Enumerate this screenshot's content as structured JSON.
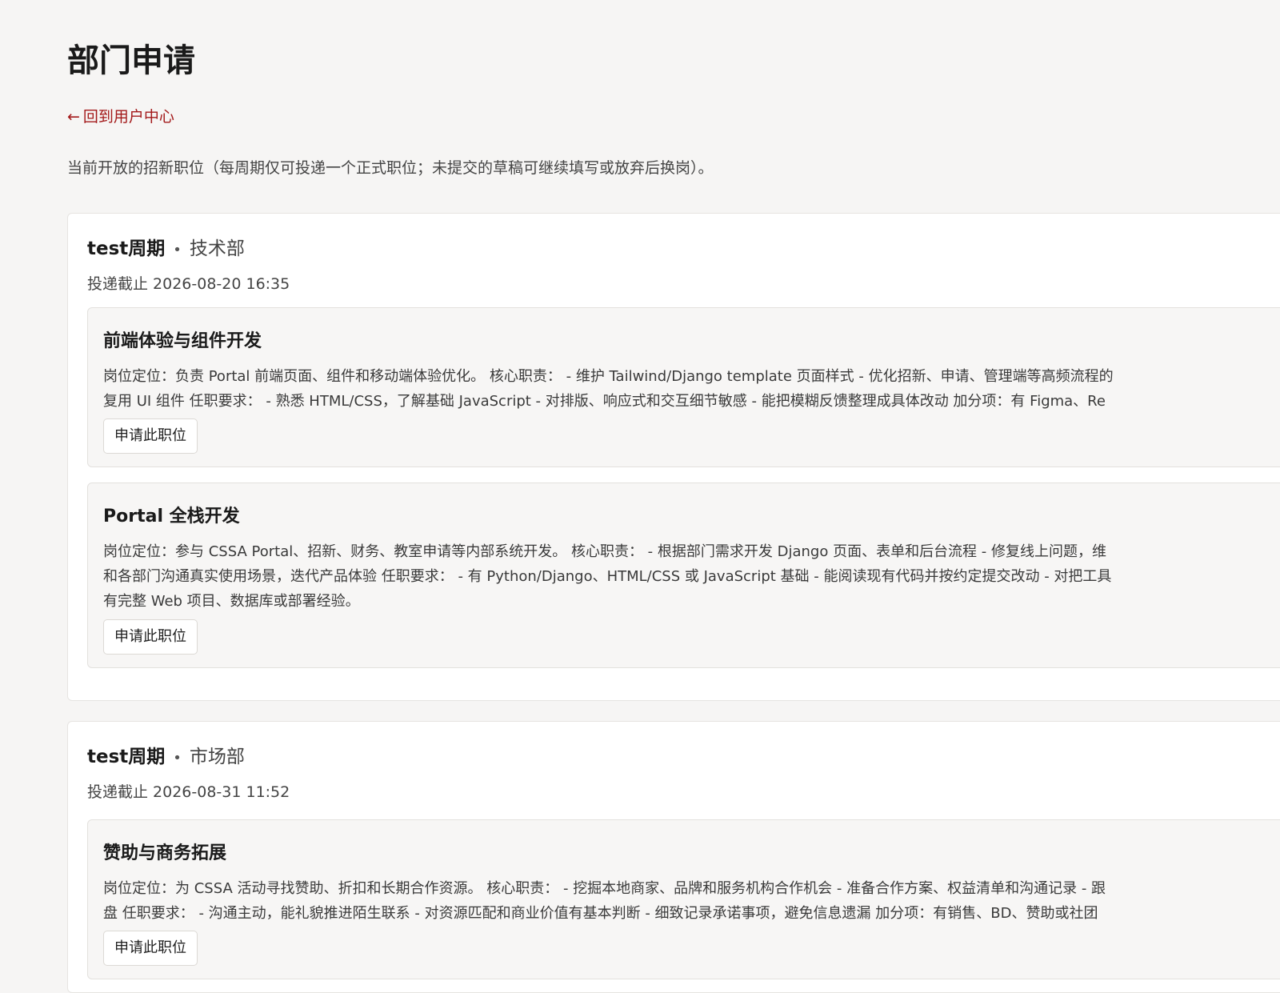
{
  "page": {
    "title": "部门申请",
    "back_link": {
      "arrow": "←",
      "label": "回到用户中心"
    },
    "intro": "当前开放的招新职位（每周期仅可投递一个正式职位；未提交的草稿可继续填写或放弃后换岗）。"
  },
  "cycles": [
    {
      "name": "test周期",
      "separator": "•",
      "department": "技术部",
      "deadline_label": "投递截止",
      "deadline": "2026-08-20 16:35",
      "positions": [
        {
          "title": "前端体验与组件开发",
          "description_lines": [
            "岗位定位：负责 Portal 前端页面、组件和移动端体验优化。 核心职责： - 维护 Tailwind/Django template 页面样式 - 优化招新、申请、管理端等高频流程的",
            "复用 UI 组件 任职要求： - 熟悉 HTML/CSS，了解基础 JavaScript - 对排版、响应式和交互细节敏感 - 能把模糊反馈整理成具体改动 加分项：有 Figma、Re"
          ],
          "apply_label": "申请此职位"
        },
        {
          "title": "Portal 全栈开发",
          "description_lines": [
            "岗位定位：参与 CSSA Portal、招新、财务、教室申请等内部系统开发。 核心职责： - 根据部门需求开发 Django 页面、表单和后台流程 - 修复线上问题，维",
            "和各部门沟通真实使用场景，迭代产品体验 任职要求： - 有 Python/Django、HTML/CSS 或 JavaScript 基础 - 能阅读现有代码并按约定提交改动 - 对把工具",
            "有完整 Web 项目、数据库或部署经验。"
          ],
          "apply_label": "申请此职位"
        }
      ]
    },
    {
      "name": "test周期",
      "separator": "•",
      "department": "市场部",
      "deadline_label": "投递截止",
      "deadline": "2026-08-31 11:52",
      "positions": [
        {
          "title": "赞助与商务拓展",
          "description_lines": [
            "岗位定位：为 CSSA 活动寻找赞助、折扣和长期合作资源。 核心职责： - 挖掘本地商家、品牌和服务机构合作机会 - 准备合作方案、权益清单和沟通记录 - 跟",
            "盘 任职要求： - 沟通主动，能礼貌推进陌生联系 - 对资源匹配和商业价值有基本判断 - 细致记录承诺事项，避免信息遗漏 加分项：有销售、BD、赞助或社团"
          ],
          "apply_label": "申请此职位"
        }
      ]
    }
  ]
}
